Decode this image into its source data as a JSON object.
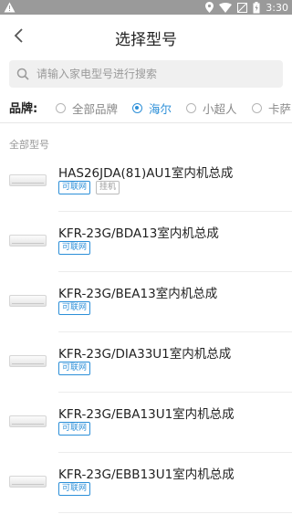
{
  "status_bar": {
    "time": "3:30"
  },
  "header": {
    "title": "选择型号"
  },
  "search": {
    "placeholder": "请输入家电型号进行搜索"
  },
  "brand_filter": {
    "label": "品牌:",
    "options": [
      "全部品牌",
      "海尔",
      "小超人",
      "卡萨"
    ],
    "selected": "海尔"
  },
  "section_title": "全部型号",
  "models": [
    {
      "name": "HAS26JDA(81)AU1室内机总成",
      "tag": "可联网",
      "extra_tag": "挂机"
    },
    {
      "name": "KFR-23G/BDA13室内机总成",
      "tag": "可联网"
    },
    {
      "name": "KFR-23G/BEA13室内机总成",
      "tag": "可联网"
    },
    {
      "name": "KFR-23G/DIA33U1室内机总成",
      "tag": "可联网"
    },
    {
      "name": "KFR-23G/EBA13U1室内机总成",
      "tag": "可联网"
    },
    {
      "name": "KFR-23G/EBB13U1室内机总成",
      "tag": "可联网"
    }
  ],
  "colors": {
    "accent": "#2c8fd8",
    "status_bar": "#9a9a9a",
    "search_bg": "#f0f0f0"
  }
}
